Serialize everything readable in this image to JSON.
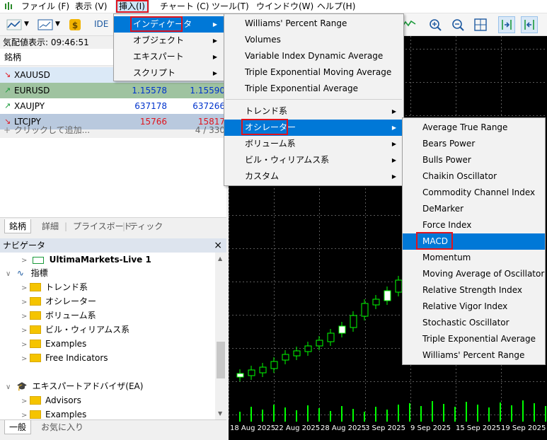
{
  "menubar": {
    "items": [
      "ファイル (F)",
      "表示 (V)",
      "挿入(I)",
      "チャート (C)",
      "ツール(T)",
      "ウインドウ(W)",
      "ヘルプ(H)"
    ]
  },
  "toolbar": {
    "ide_label": "IDE"
  },
  "market_watch": {
    "title": "気配値表示: 09:46:51",
    "header_symbol": "銘柄",
    "rows": [
      {
        "dir": "down",
        "symbol": "XAUUSD",
        "bid": "",
        "ask": "",
        "bg": "#dbe9f7",
        "color": "#000000"
      },
      {
        "dir": "up",
        "symbol": "EURUSD",
        "bid": "1.15578",
        "ask": "1.15590",
        "bg": "#9fc3a0",
        "color": "#0033cc"
      },
      {
        "dir": "up",
        "symbol": "XAUJPY",
        "bid": "637178",
        "ask": "637266",
        "bg": "#ffffff",
        "color": "#0033cc"
      },
      {
        "dir": "down",
        "symbol": "LTCJPY",
        "bid": "15766",
        "ask": "15817",
        "bg": "#b9c9de",
        "color": "#e0141e"
      }
    ],
    "add_label": "クリックして追加...",
    "count": "4 / 330",
    "tabs": [
      "銘柄",
      "詳細",
      "プライスボード",
      "ティック"
    ]
  },
  "navigator": {
    "title": "ナビゲータ",
    "close": "×",
    "account": "UltimaMarkets-Live 1",
    "indicators_label": "指標",
    "indicator_folders": [
      "トレンド系",
      "オシレーター",
      "ボリューム系",
      "ビル・ウィリアムス系",
      "Examples",
      "Free Indicators"
    ],
    "ea_label": "エキスパートアドバイザ(EA)",
    "ea_folders": [
      "Advisors",
      "Examples"
    ],
    "tabs": [
      "一般",
      "お気に入り"
    ]
  },
  "chart": {
    "x_labels": [
      "18 Aug 2025",
      "22 Aug 2025",
      "28 Aug 2025",
      "3 Sep 2025",
      "9 Sep 2025",
      "15 Sep 2025",
      "19 Sep 2025"
    ]
  },
  "insert_menu": {
    "items": [
      "インディケータ",
      "オブジェクト",
      "エキスパート",
      "スクリプト"
    ]
  },
  "indicator_menu": {
    "items_top": [
      "Williams' Percent Range",
      "Volumes",
      "Variable Index Dynamic Average",
      "Triple Exponential Moving Average",
      "Triple Exponential Average"
    ],
    "items_bottom": [
      "トレンド系",
      "オシレーター",
      "ボリューム系",
      "ビル・ウィリアムス系",
      "カスタム"
    ]
  },
  "oscillator_menu": {
    "items": [
      "Average True Range",
      "Bears Power",
      "Bulls Power",
      "Chaikin Oscillator",
      "Commodity Channel Index",
      "DeMarker",
      "Force Index",
      "MACD",
      "Momentum",
      "Moving Average of Oscillator",
      "Relative Strength Index",
      "Relative Vigor Index",
      "Stochastic Oscillator",
      "Triple Exponential Average",
      "Williams' Percent Range"
    ]
  },
  "colors": {
    "highlight": "#0078d7",
    "annotation": "#e0141e",
    "up": "#00ff00",
    "chart_bg": "#000000"
  }
}
